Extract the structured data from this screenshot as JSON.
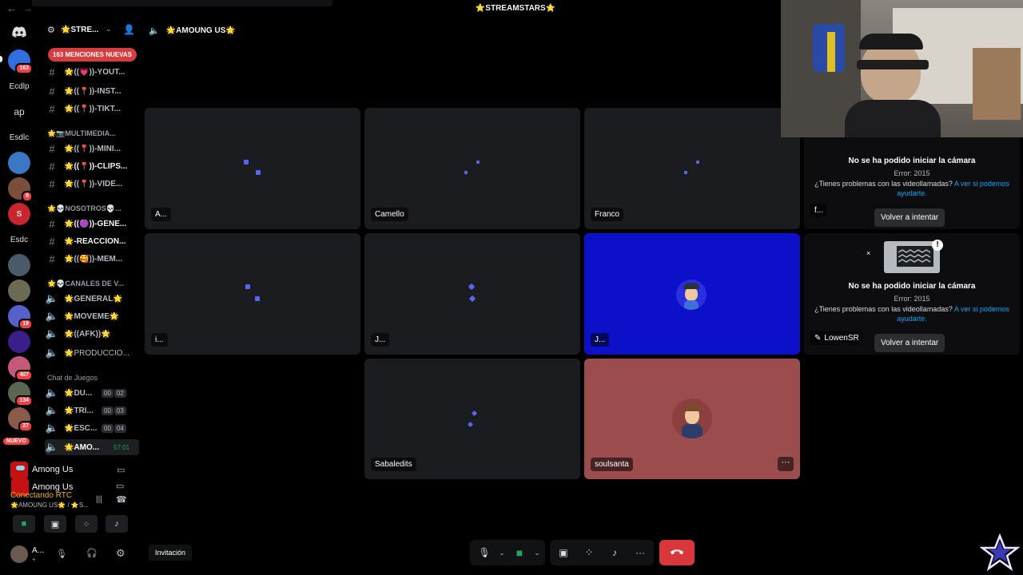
{
  "window": {
    "title": "⭐STREAMSTARS⭐"
  },
  "rail": {
    "home_badge": "163",
    "servers": [
      {
        "label": "Ecdlp"
      },
      {
        "label": "ap"
      },
      {
        "label": "Esdlc"
      },
      {
        "label": "Esdc"
      }
    ],
    "badges": [
      "8",
      "19",
      "407",
      "134",
      "27"
    ],
    "new_label": "NUEVO"
  },
  "sidebar": {
    "guild_name": "🌟STRE...",
    "mentions_label": "163 MENCIONES NUEVAS",
    "channels_top": [
      {
        "name": "🌟((💗))-YOUT..."
      },
      {
        "name": "🌟((📍))-INST..."
      },
      {
        "name": "🌟((📍))-TIKT..."
      }
    ],
    "cat_multimedia": "🌟📷MULTIMEDIA...",
    "channels_multimedia": [
      {
        "name": "🌟((📍))-MINI..."
      },
      {
        "name": "🌟((📍))-CLIPS..."
      },
      {
        "name": "🌟((📍))-VIDE..."
      }
    ],
    "cat_nosotros": "🌟💀NOSOTROS💀...",
    "channels_nosotros": [
      {
        "name": "🌟((🟣))-GENE..."
      },
      {
        "name": "🌟-REACCION..."
      },
      {
        "name": "🌟((🥰))-MEM..."
      }
    ],
    "cat_canales": "🌟💀CANALES DE V...",
    "voice_channels": [
      {
        "name": "🌟GENERAL🌟"
      },
      {
        "name": "🌟MOVEME🌟"
      },
      {
        "name": "🌟((AFK))🌟"
      },
      {
        "name": "🌟PRODUCCIO..."
      }
    ],
    "cat_juegos": "Chat de Juegos",
    "game_channels": [
      {
        "name": "🌟DU...",
        "a": "00",
        "b": "02"
      },
      {
        "name": "🌟TRI...",
        "a": "00",
        "b": "03"
      },
      {
        "name": "🌟ESC...",
        "a": "00",
        "b": "04"
      },
      {
        "name": "🌟AMO...",
        "timer": "57:01"
      }
    ]
  },
  "activity": {
    "name": "Among Us"
  },
  "rtc": {
    "status": "Conectando RTC",
    "channel": "🌟AMOUNG US🌟 / ⭐S..."
  },
  "user": {
    "name": "A...",
    "sub": "+"
  },
  "voice": {
    "channel_name": "🌟AMOUNG US🌟",
    "tiles": [
      {
        "label": "A..."
      },
      {
        "label": "Camello"
      },
      {
        "label": "Franco"
      },
      {
        "label": "f..."
      },
      {
        "label": "i..."
      },
      {
        "label": "J..."
      },
      {
        "label": "J..."
      },
      {
        "label": "LowenSR"
      },
      {
        "label": "Sabaledits"
      },
      {
        "label": "soulsanta"
      }
    ],
    "error": {
      "title": "No se ha podido iniciar la cámara",
      "code": "Error: 2015",
      "help": "¿Tienes problemas con las videollamadas?",
      "help_link": "A ver si podemos ayudarte.",
      "retry": "Volver a intentar"
    },
    "invite": "Invitación"
  },
  "colors": {
    "accent": "#5865f2",
    "tile_blue": "#0c10c8",
    "tile_red": "#9b4d4d",
    "hangup": "#da373c",
    "rtc_status": "#f0b232"
  }
}
